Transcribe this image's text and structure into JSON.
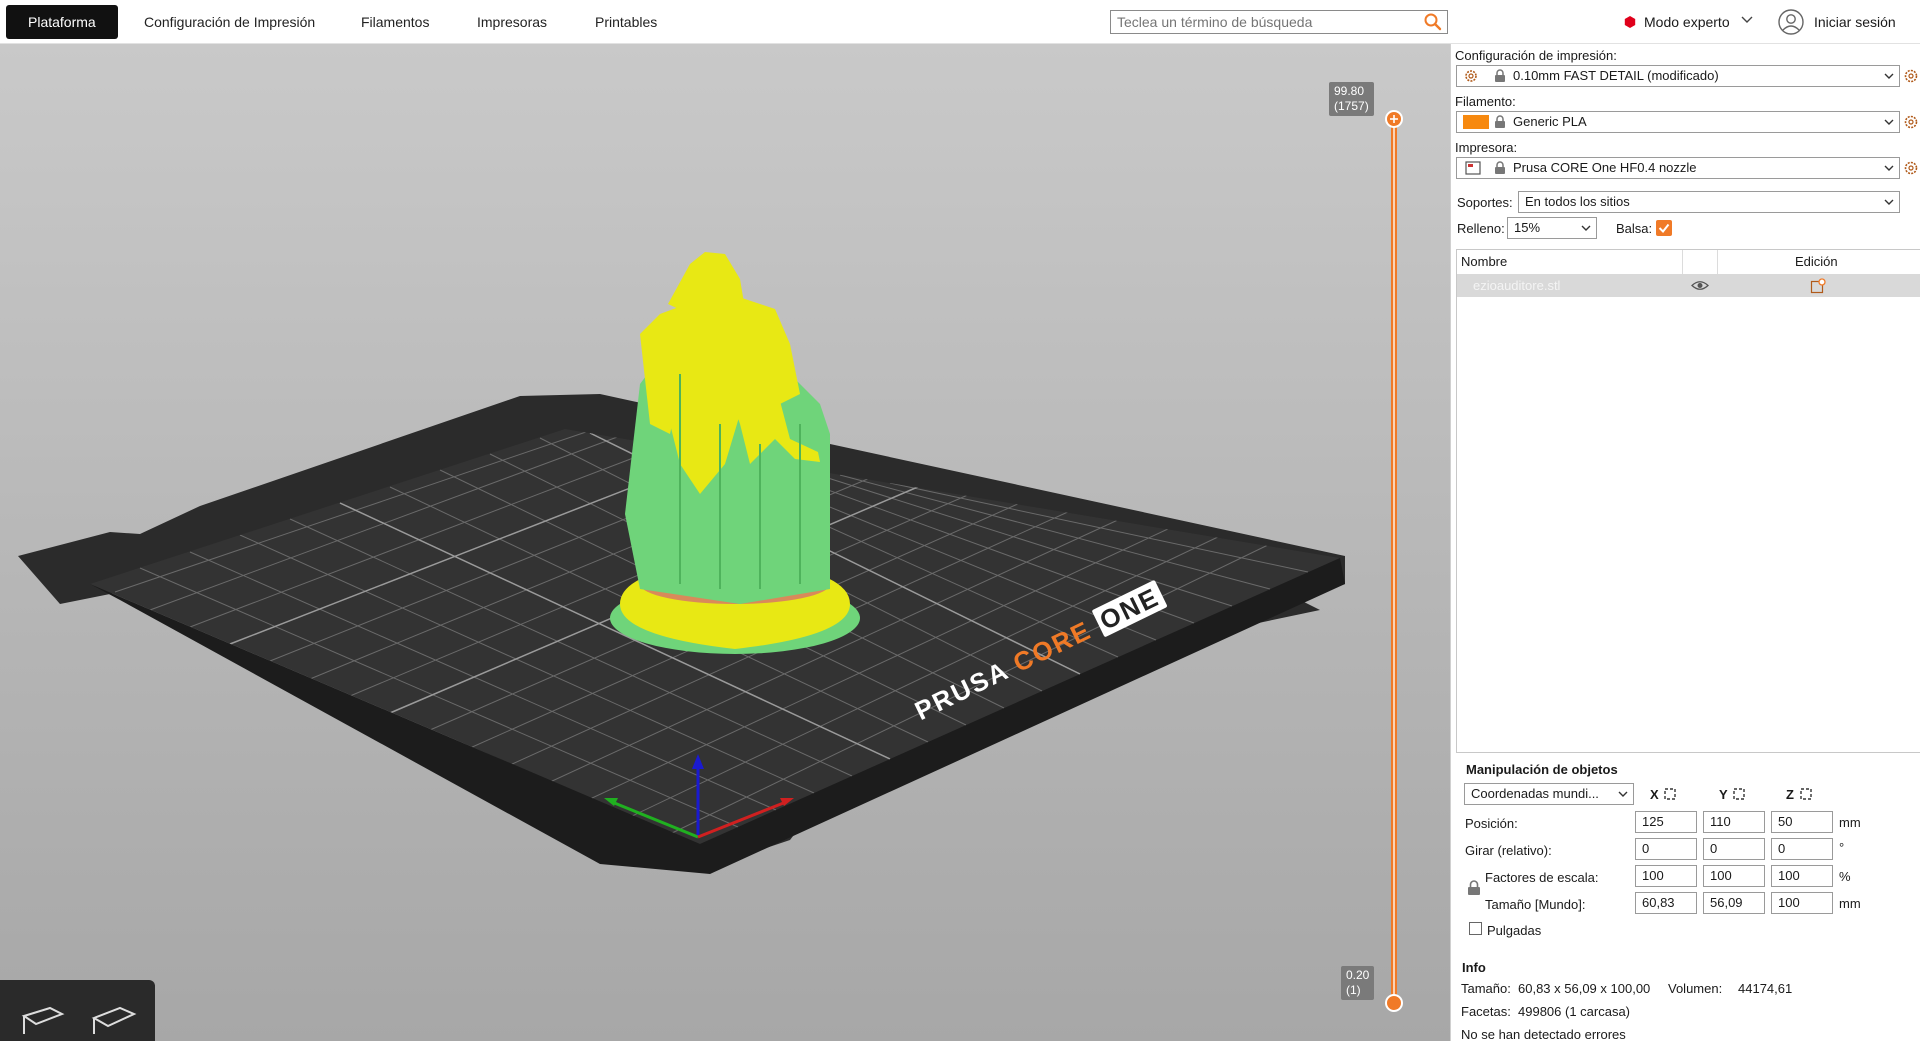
{
  "topbar": {
    "tabs": [
      "Plataforma",
      "Configuración de Impresión",
      "Filamentos",
      "Impresoras",
      "Printables"
    ],
    "search_placeholder": "Teclea un término de búsqueda",
    "mode_label": "Modo experto",
    "login_label": "Iniciar sesión",
    "accent_color": "#f07a27",
    "expert_color": "#e0001b"
  },
  "viewport": {
    "bed_logo": {
      "word1": "PRUSA",
      "word2": "CORE",
      "word3": "ONE"
    },
    "slider": {
      "top_value": "99.80",
      "top_layer": "(1757)",
      "bottom_value": "0.20",
      "bottom_layer": "(1)"
    },
    "model_colors": {
      "perimeter": "#e8e814",
      "support": "#6fd47a",
      "bed": "#2b2b2b"
    }
  },
  "sidebar": {
    "print_settings_label": "Configuración de impresión:",
    "print_settings_value": "0.10mm FAST DETAIL (modificado)",
    "filament_label": "Filamento:",
    "filament_value": "Generic PLA",
    "filament_color": "#f7890f",
    "printer_label": "Impresora:",
    "printer_value": "Prusa CORE One HF0.4 nozzle",
    "supports_label": "Soportes:",
    "supports_value": "En todos los sitios",
    "infill_label": "Relleno:",
    "infill_value": "15%",
    "brim_label": "Balsa:",
    "brim_checked": true,
    "list": {
      "col_name": "Nombre",
      "col_edit": "Edición",
      "row_name": "ezioauditore.stl"
    },
    "manip": {
      "title": "Manipulación de objetos",
      "coords_value": "Coordenadas mundi...",
      "axes": [
        "X",
        "Y",
        "Z"
      ],
      "position_label": "Posición:",
      "position": [
        "125",
        "110",
        "50"
      ],
      "position_unit": "mm",
      "rotate_label": "Girar (relativo):",
      "rotate": [
        "0",
        "0",
        "0"
      ],
      "rotate_unit": "°",
      "scale_label": "Factores de escala:",
      "scale": [
        "100",
        "100",
        "100"
      ],
      "scale_unit": "%",
      "size_label": "Tamaño [Mundo]:",
      "size": [
        "60,83",
        "56,09",
        "100"
      ],
      "size_unit": "mm",
      "inches_label": "Pulgadas"
    },
    "info": {
      "title": "Info",
      "size_label": "Tamaño:",
      "size_value": "60,83 x 56,09 x 100,00",
      "volume_label": "Volumen:",
      "volume_value": "44174,61",
      "facets_label": "Facetas:",
      "facets_value": "499806 (1 carcasa)",
      "errors_text": "No se han detectado errores"
    }
  }
}
